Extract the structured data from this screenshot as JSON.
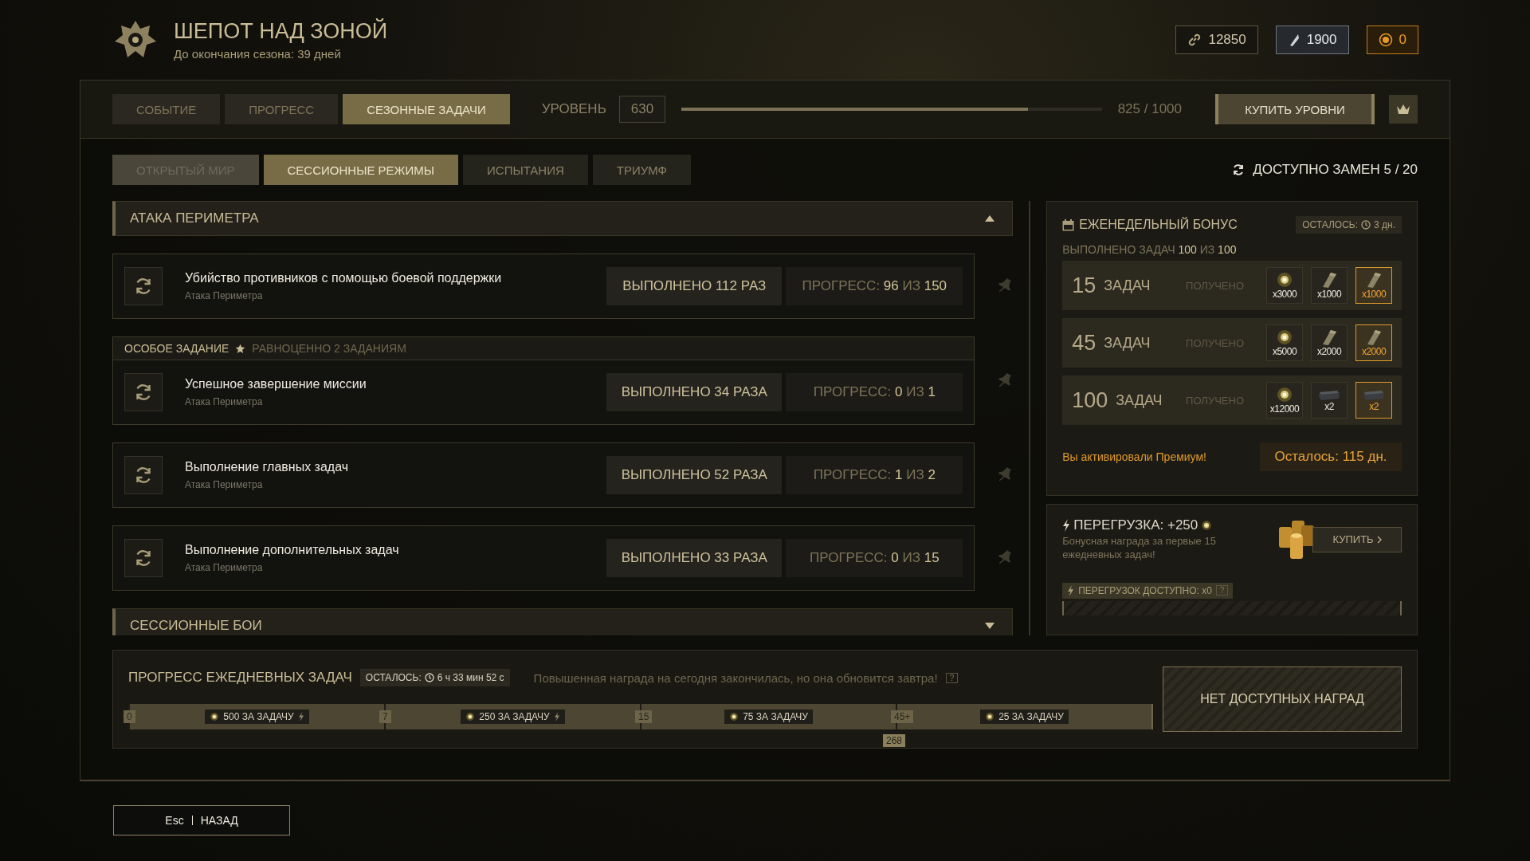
{
  "header": {
    "title": "ШЕПОТ НАД ЗОНОЙ",
    "subtitle": "До окончания сезона: 39 дней",
    "currencies": [
      {
        "kind": "link",
        "value": "12850"
      },
      {
        "kind": "blade",
        "value": "1900"
      },
      {
        "kind": "coin",
        "value": "0"
      }
    ]
  },
  "tabs": [
    {
      "label": "СОБЫТИЕ",
      "selected": false
    },
    {
      "label": "ПРОГРЕСС",
      "selected": false
    },
    {
      "label": "СЕЗОННЫЕ ЗАДАЧИ",
      "selected": true
    }
  ],
  "season_level": {
    "label": "УРОВЕНЬ",
    "value": "630",
    "level": 0.825,
    "reading": "825 / 1000"
  },
  "buy_levels": "КУПИТЬ УРОВНИ",
  "subtabs": [
    {
      "label": "ОТКРЫТЫЙ МИР",
      "selected": false,
      "disabled": true
    },
    {
      "label": "СЕССИОННЫЕ РЕЖИМЫ",
      "selected": true,
      "disabled": false
    },
    {
      "label": "ИСПЫТАНИЯ",
      "selected": false,
      "disabled": false
    },
    {
      "label": "ТРИУМФ",
      "selected": false,
      "disabled": false
    }
  ],
  "replacements": "ДОСТУПНО ЗАМЕН 5 / 20",
  "sections": [
    {
      "title": "АТАКА ПЕРИМЕТРА",
      "expanded": true,
      "tasks": [
        {
          "name": "Убийство противников с помощью боевой поддержки",
          "mode": "Атака Периметра",
          "done": "ВЫПОЛНЕНО 112 РАЗ",
          "progress": "ПРОГРЕСС: **96** ИЗ **150**"
        },
        {
          "special": {
            "label": "ОСОБОЕ ЗАДАНИЕ",
            "note": "РАВНОЦЕННО 2 ЗАДАНИЯМ"
          },
          "name": "Успешное завершение миссии",
          "mode": "Атака Периметра",
          "done": "ВЫПОЛНЕНО 34 РАЗА",
          "progress": "ПРОГРЕСС: **0** ИЗ **1**"
        },
        {
          "name": "Выполнение главных задач",
          "mode": "Атака Периметра",
          "done": "ВЫПОЛНЕНО 52 РАЗА",
          "progress": "ПРОГРЕСС: **1** ИЗ **2**"
        },
        {
          "name": "Выполнение дополнительных задач",
          "mode": "Атака Периметра",
          "done": "ВЫПОЛНЕНО 33 РАЗА",
          "progress": "ПРОГРЕСС: **0** ИЗ **15**"
        }
      ]
    },
    {
      "title": "СЕССИОННЫЕ БОИ",
      "expanded": false
    }
  ],
  "weekly": {
    "title": "ЕЖЕНЕДЕЛЬНЫЙ БОНУС",
    "remaining_label": "ОСТАЛОСЬ:",
    "remaining": "3 дн.",
    "done": "ВЫПОЛНЕНО ЗАДАЧ **100** ИЗ **100**",
    "tiers": [
      {
        "count": "15",
        "unit": "ЗАДАЧ",
        "status": "ПОЛУЧЕНО",
        "rewards": [
          {
            "kind": "orb",
            "amount": "x3000",
            "premium": false
          },
          {
            "kind": "plate",
            "amount": "x1000",
            "premium": false
          },
          {
            "kind": "plate",
            "amount": "x1000",
            "premium": true
          }
        ]
      },
      {
        "count": "45",
        "unit": "ЗАДАЧ",
        "status": "ПОЛУЧЕНО",
        "rewards": [
          {
            "kind": "orb",
            "amount": "x5000",
            "premium": false
          },
          {
            "kind": "plate",
            "amount": "x2000",
            "premium": false
          },
          {
            "kind": "plate",
            "amount": "x2000",
            "premium": true
          }
        ]
      },
      {
        "count": "100",
        "unit": "ЗАДАЧ",
        "status": "ПОЛУЧЕНО",
        "rewards": [
          {
            "kind": "orb",
            "amount": "x12000",
            "premium": false
          },
          {
            "kind": "case",
            "amount": "x2",
            "premium": false
          },
          {
            "kind": "case",
            "amount": "x2",
            "premium": true
          }
        ]
      }
    ],
    "premium_note": "Вы активировали Премиум!",
    "premium_remaining": "Осталось: 115 дн."
  },
  "overload": {
    "title": "ПЕРЕГРУЗКА: +250",
    "description": "Бонусная награда за первые 15 ежедневных задач!",
    "buy": "КУПИТЬ",
    "available": "ПЕРЕГРУЗОК ДОСТУПНО: x0",
    "help": "?"
  },
  "daily": {
    "title": "ПРОГРЕСС ЕЖЕДНЕВНЫХ ЗАДАЧ",
    "remaining_label": "ОСТАЛОСЬ:",
    "remaining": "6 ч 33 мин 52 с",
    "notice": "Повышенная награда на сегодня закончилась, но она обновится завтра!",
    "help": "?",
    "segments": [
      {
        "start": "0",
        "reward": "500 ЗА ЗАДАЧУ",
        "boost": true
      },
      {
        "start": "7",
        "reward": "250 ЗА ЗАДАЧУ",
        "boost": true
      },
      {
        "start": "15",
        "reward": "75 ЗА ЗАДАЧУ",
        "boost": false
      },
      {
        "start": "45+",
        "reward": "25 ЗА ЗАДАЧУ",
        "boost": false
      }
    ],
    "current": "268",
    "claim": "НЕТ ДОСТУПНЫХ НАГРАД"
  },
  "back": {
    "key": "Esc",
    "label": "НАЗАД"
  }
}
